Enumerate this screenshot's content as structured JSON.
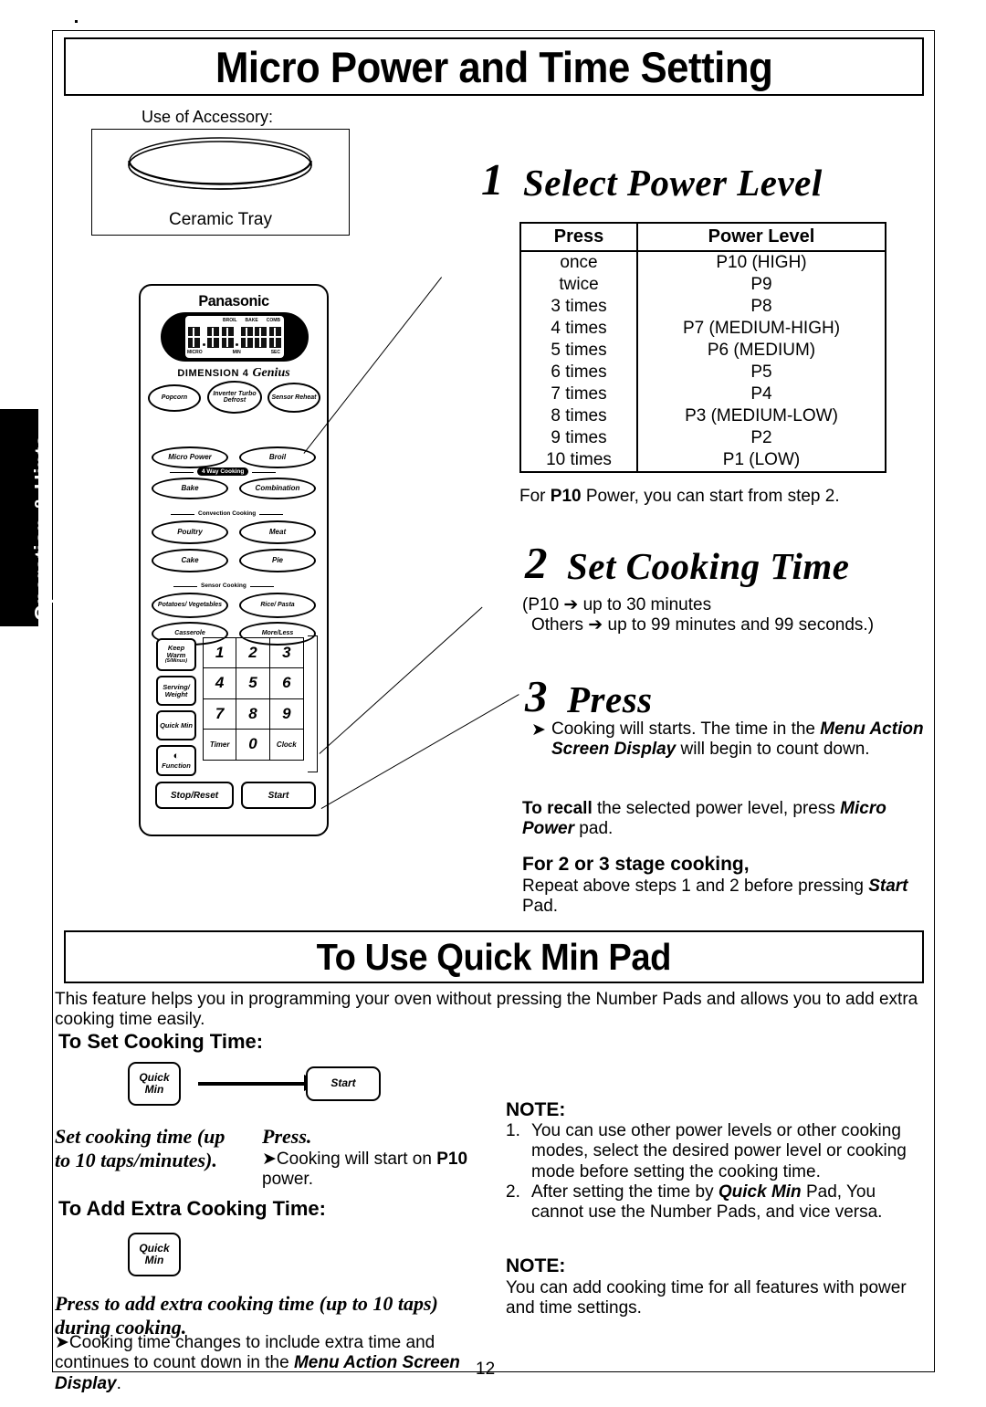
{
  "sidebar": {
    "tab_label": "Operation & Hints"
  },
  "headings": {
    "top_banner": "Micro Power and Time Setting",
    "mid_banner": "To Use Quick Min Pad"
  },
  "accessory": {
    "label": "Use of Accessory:",
    "caption": "Ceramic Tray"
  },
  "panel": {
    "brand": "Panasonic",
    "display": {
      "top_indicators": [
        "BROIL",
        "BAKE",
        "COMB"
      ],
      "bottom_indicators": [
        "MICRO",
        "MIN",
        "SEC"
      ]
    },
    "model_line": "DIMENSION 4",
    "model_script": "Genius",
    "buttons": {
      "popcorn": "Popcorn",
      "inverter_turbo_defrost": "Inverter Turbo Defrost",
      "sensor_reheat": "Sensor Reheat",
      "micro_power": "Micro Power",
      "broil": "Broil",
      "bake": "Bake",
      "combination": "Combination",
      "poultry": "Poultry",
      "meat": "Meat",
      "cake": "Cake",
      "pie": "Pie",
      "potatoes_vegetables": "Potatoes/ Vegetables",
      "rice_pasta": "Rice/ Pasta",
      "casserole": "Casserole",
      "more_less": "More/Less",
      "keep_warm": "Keep Warm",
      "keep_warm_sub": "(5/Minus)",
      "serving_weight": "Serving/ Weight",
      "quick_min": "Quick Min",
      "function": "Function",
      "stop_reset": "Stop/Reset",
      "start": "Start",
      "timer": "Timer",
      "clock": "Clock"
    },
    "section_labels": {
      "four_way_cooking": "4 Way Cooking",
      "convection_cooking": "Convection Cooking",
      "sensor_cooking": "Sensor Cooking"
    },
    "number_keys": [
      "1",
      "2",
      "3",
      "4",
      "5",
      "6",
      "7",
      "8",
      "9",
      "0"
    ]
  },
  "steps": {
    "one": {
      "number": "1",
      "title": "Select Power Level"
    },
    "two": {
      "number": "2",
      "title": "Set Cooking Time",
      "note_line1": "(P10 ➔ up to 30 minutes",
      "note_line2": "Others ➔ up to 99 minutes and 99 seconds.)"
    },
    "three": {
      "number": "3",
      "title": "Press",
      "bullet_prefix": "Cooking will starts. The time in the ",
      "bullet_em1": "Menu Action Screen Display",
      "bullet_suffix": " will begin to count down.",
      "recall_bold": "To recall",
      "recall_mid": " the selected power level, press ",
      "recall_em": "Micro Power",
      "recall_end": " pad.",
      "stage_heading": "For 2 or 3 stage cooking,",
      "stage_text_a": "Repeat above steps 1 and 2 before pressing ",
      "stage_em": "Start",
      "stage_text_b": " Pad."
    }
  },
  "power_table": {
    "col_press": "Press",
    "col_level": "Power Level",
    "rows": [
      {
        "press": "once",
        "level": "P10 (HIGH)"
      },
      {
        "press": "twice",
        "level": "P9"
      },
      {
        "press": "3 times",
        "level": "P8"
      },
      {
        "press": "4 times",
        "level": "P7 (MEDIUM-HIGH)"
      },
      {
        "press": "5 times",
        "level": "P6 (MEDIUM)"
      },
      {
        "press": "6 times",
        "level": "P5"
      },
      {
        "press": "7 times",
        "level": "P4"
      },
      {
        "press": "8 times",
        "level": "P3 (MEDIUM-LOW)"
      },
      {
        "press": "9 times",
        "level": "P2"
      },
      {
        "press": "10 times",
        "level": "P1 (LOW)"
      }
    ],
    "footnote_a": "For ",
    "footnote_b": "P10",
    "footnote_c": " Power, you can start from step 2."
  },
  "quickmin": {
    "intro": "This feature helps you in programming your oven without pressing the Number Pads and allows you to add extra cooking time easily.",
    "set_heading": "To Set Cooking Time:",
    "pad_quick_min": "Quick Min",
    "pad_start": "Start",
    "set_caption_left": "Set cooking time (up to 10 taps/minutes).",
    "set_caption_right": "Press.",
    "set_bullet_a": "Cooking will start on ",
    "set_bullet_b": "P10",
    "set_bullet_c": " power.",
    "add_heading": "To Add Extra Cooking Time:",
    "add_caption": "Press to add extra cooking time (up to 10 taps) during cooking.",
    "add_bullet_a": "Cooking time changes to include extra time and continues to count down in the ",
    "add_bullet_em": "Menu Action Screen Display",
    "add_bullet_b": ".",
    "note1_title": "NOTE:",
    "note1_items": [
      "You can use other power levels or other cooking modes, select the desired power level or cooking mode before setting the cooking time.",
      "After setting the time by Quick Min Pad, You cannot use the Number Pads, and vice versa."
    ],
    "note1_item2_a": "After setting the time by ",
    "note1_item2_em": "Quick Min",
    "note1_item2_b": " Pad, You cannot use the Number Pads, and vice versa.",
    "note2_title": "NOTE:",
    "note2_text": "You can add cooking time for all features with power and time settings."
  },
  "page_number": "12"
}
